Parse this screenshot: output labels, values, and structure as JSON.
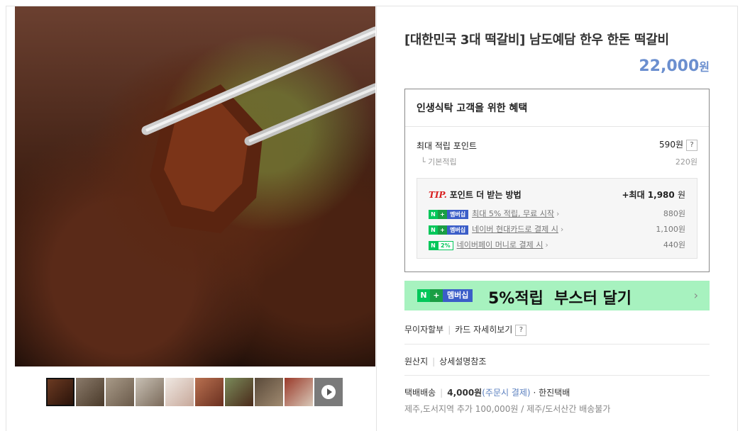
{
  "product": {
    "title": "[대한민국 3대 떡갈비] 남도예담 한우 한돈 떡갈비",
    "price": "22,000",
    "price_unit": "원"
  },
  "gallery": {
    "main_image": "grilled-tteokgalbi-photo",
    "thumbnail_count": 10
  },
  "benefit": {
    "title": "인생식탁 고객을 위한 혜택",
    "max_points_label": "최대 적립 포인트",
    "max_points_value": "590원",
    "help": "?",
    "basic_label": "└ 기본적립",
    "basic_value": "220원",
    "tip": {
      "tip_label": "TIP.",
      "head": "포인트 더 받는 방법",
      "max_prefix": "+최대",
      "max_value": "1,980",
      "max_unit": "원",
      "rows": [
        {
          "badge_n": "N",
          "badge_plus": "+",
          "badge_text": "멤버십",
          "text": "최대 5% 적립, 무료 시작",
          "value": "880원"
        },
        {
          "badge_n": "N",
          "badge_plus": "+",
          "badge_text": "멤버십",
          "text": "네이버 현대카드로 결제 시",
          "value": "1,100원"
        },
        {
          "badge_n": "N",
          "badge_text": "2%",
          "text": "네이버페이 머니로 결제 시",
          "value": "440원"
        }
      ]
    }
  },
  "banner": {
    "badge_n": "N",
    "badge_plus": "+",
    "badge_text": "멤버십",
    "text": "5%적립  부스터 달기",
    "arrow": "›"
  },
  "installment": {
    "label": "무이자할부",
    "card_link": "카드 자세히보기",
    "help": "?"
  },
  "origin": {
    "label": "원산지",
    "value": "상세설명참조"
  },
  "delivery": {
    "label": "택배배송",
    "fee": "4,000원",
    "fee_note": "(주문시 결제)",
    "dot": "·",
    "carrier": "한진택배",
    "extra": "제주,도서지역 추가 100,000원 / 제주/도서산간 배송불가"
  },
  "colors": {
    "price": "#6b8fcf",
    "naver_green": "#03c75a",
    "banner_bg": "#a7f2bf",
    "tip_red": "#d92020"
  }
}
